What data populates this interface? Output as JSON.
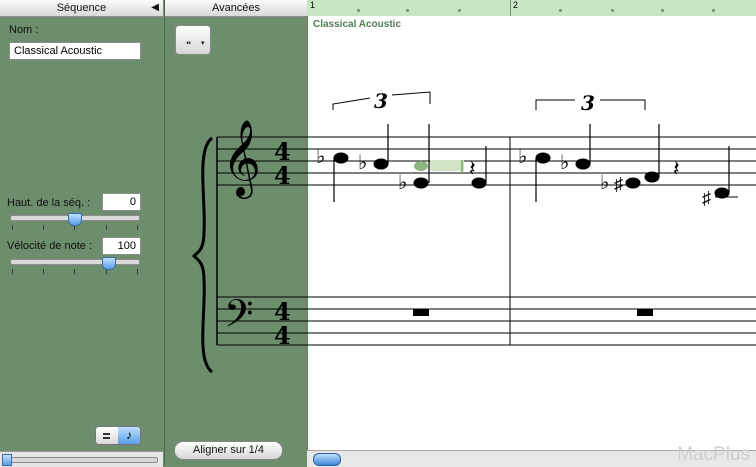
{
  "left_panel": {
    "header": "Séquence",
    "name_label": "Nom :",
    "name_value": "Classical Acoustic",
    "pitch_label": "Haut. de la séq. :",
    "pitch_value": "0",
    "pitch_slider_level": 0.5,
    "velocity_label": "Vélocité de note :",
    "velocity_value": "100",
    "velocity_slider_level": 0.79
  },
  "mid_panel": {
    "header": "Avancées",
    "note_value_button_icon": "whole-note-icon",
    "align_button": "Aligner sur 1/4"
  },
  "ruler": {
    "bars": [
      "1",
      "2"
    ]
  },
  "score": {
    "track_name": "Classical Acoustic",
    "time_signature": "4/4",
    "tuplet_label": "3",
    "accent_color": "#4f7f4f",
    "selected_note_color": "#8fb57f"
  },
  "watermark": "MacPlus"
}
